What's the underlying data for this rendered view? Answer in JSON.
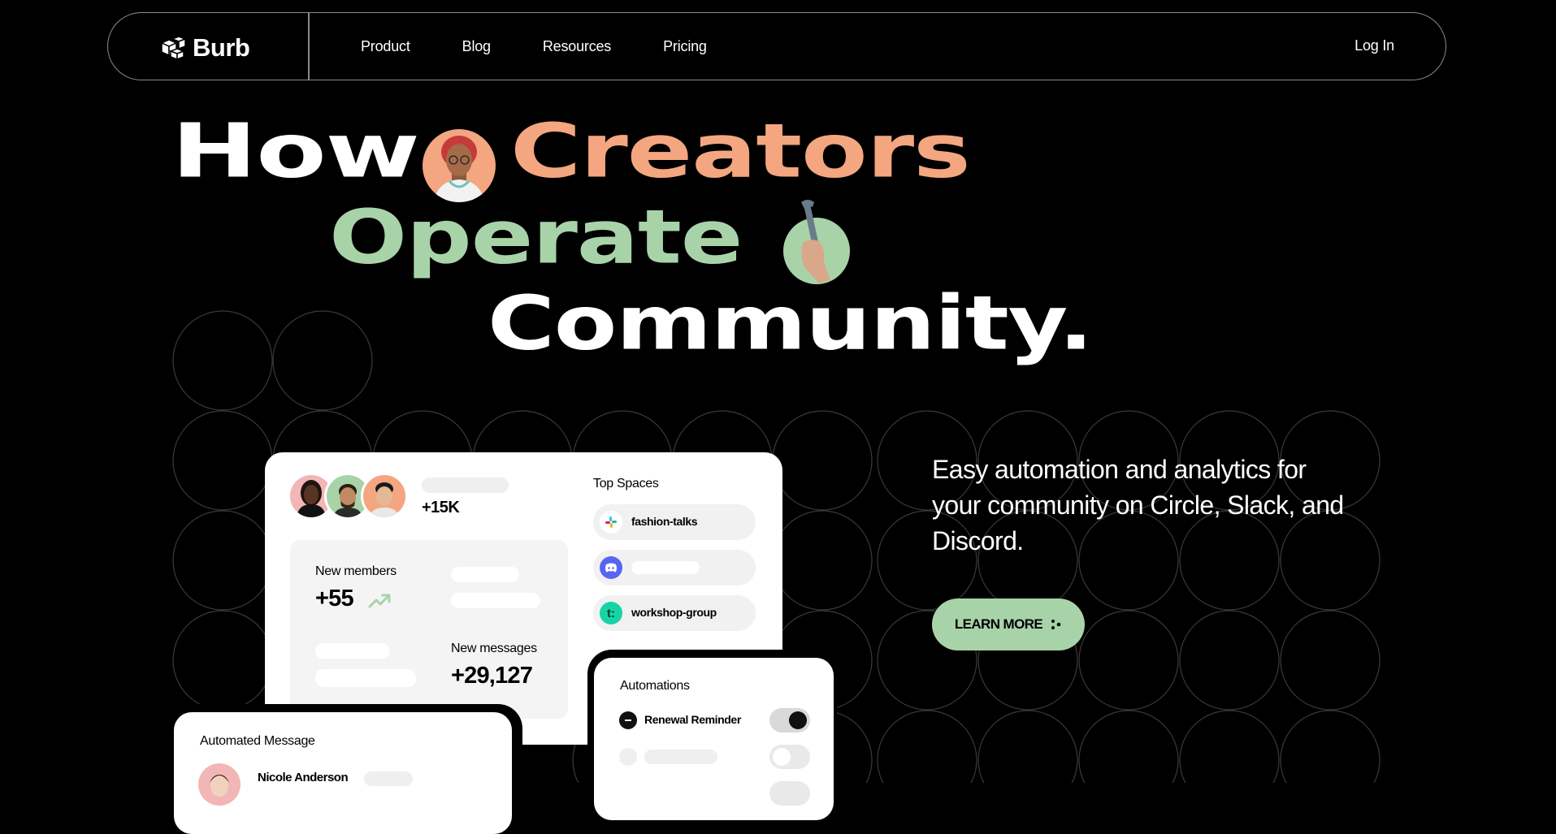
{
  "nav": {
    "brand": "Burb",
    "links": [
      "Product",
      "Blog",
      "Resources",
      "Pricing"
    ],
    "login": "Log In"
  },
  "hero": {
    "line1_word1": "How",
    "line1_word2": "Creators",
    "line2": "Operate",
    "line3": "Community."
  },
  "tagline": "Easy automation and analytics for your community on Circle, Slack, and Discord.",
  "cta": {
    "label": "LEARN MORE"
  },
  "dashboard": {
    "members_count": "+15K",
    "new_members_label": "New members",
    "new_members_value": "+55",
    "new_messages_label": "New messages",
    "new_messages_value": "+29,127",
    "top_spaces_title": "Top Spaces",
    "spaces": [
      {
        "name": "fashion-talks",
        "icon": "slack-icon"
      },
      {
        "name": "",
        "icon": "discord-icon"
      },
      {
        "name": "workshop-group",
        "icon": "circle-t-icon"
      }
    ],
    "automations_title": "Automations",
    "automation_1": "Renewal Reminder",
    "message_title": "Automated Message",
    "message_sender": "Nicole Anderson"
  },
  "colors": {
    "peach": "#f4a680",
    "green": "#a8d3a9",
    "background": "#000000"
  }
}
